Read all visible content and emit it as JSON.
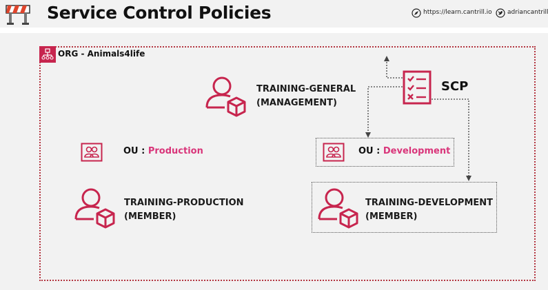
{
  "header": {
    "title": "Service Control Policies",
    "website": "https://learn.cantrill.io",
    "twitter": "adriancantrill"
  },
  "org": {
    "label": "ORG - Animals4life"
  },
  "accounts": {
    "general": {
      "line1": "TRAINING-GENERAL",
      "line2": "(MANAGEMENT)"
    },
    "production": {
      "line1": "TRAINING-PRODUCTION",
      "line2": "(MEMBER)"
    },
    "development": {
      "line1": "TRAINING-DEVELOPMENT",
      "line2": "(MEMBER)"
    }
  },
  "ous": {
    "production": {
      "prefix": "OU : ",
      "name": "Production"
    },
    "development": {
      "prefix": "OU : ",
      "name": "Development"
    }
  },
  "scp": {
    "label": "SCP"
  },
  "colors": {
    "accent": "#c7254e",
    "ou_name": "#d9357a",
    "org_border": "#b3343f"
  }
}
